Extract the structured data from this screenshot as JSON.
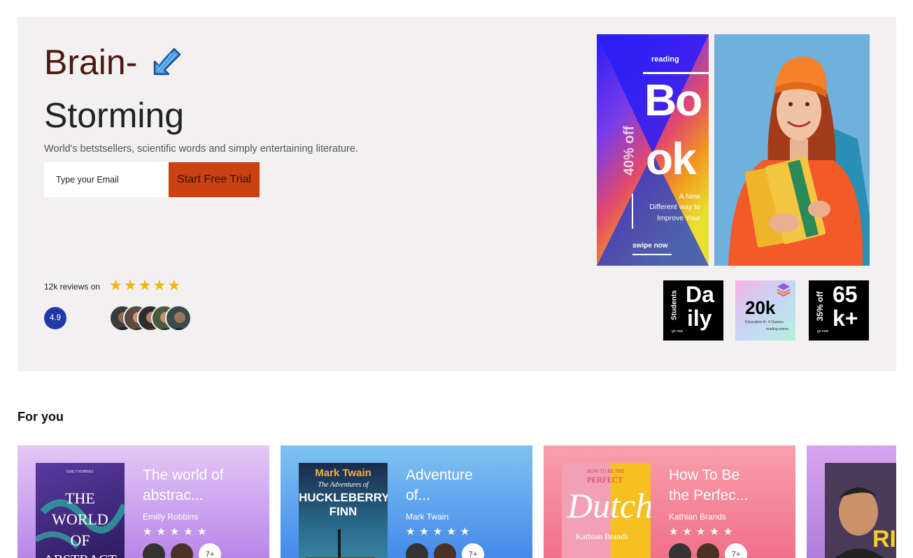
{
  "hero": {
    "title_line1": "Brain-",
    "title_line2": "Storming",
    "subtitle": "World's betstsellers, scientific words and simply entertaining literature.",
    "email_placeholder": "Type your Email",
    "cta_label": "Start Free Trial",
    "reviews_text": "12k reviews on",
    "star_count": 5,
    "rating": "4.9",
    "avatar_count": 5,
    "book_cover": {
      "top_word": "reading",
      "big_text_line1": "Bo",
      "big_text_line2": "ok",
      "discount": "40% off",
      "tagline_line1": "A New",
      "tagline_line2": "Different way to",
      "tagline_line3": "Improve Your",
      "cta": "swipe now"
    },
    "thumbs": [
      {
        "side_text": "Students",
        "main_line1": "Da",
        "main_line2": "ily",
        "small": "go now"
      },
      {
        "main": "20k",
        "small": "Education A- 4 Games",
        "small2": "reading rooms"
      },
      {
        "side_text": "35% off",
        "main_line1": "65",
        "main_line2": "k+",
        "small": "go now"
      }
    ]
  },
  "section": {
    "title": "For you"
  },
  "cards": [
    {
      "title": "The world of abstrac...",
      "author": "Emilly Robbins",
      "more": "7+",
      "cover_title_1": "THE",
      "cover_title_2": "WORLD",
      "cover_title_3": "OF",
      "cover_title_4": "ABSTRACT",
      "cover_author": "EMILY ROBBINS"
    },
    {
      "title": "Adventure of...",
      "author": "Mark Twain",
      "more": "7+",
      "cover_author": "Mark Twain",
      "cover_sub": "The Adventures of",
      "cover_title_1": "HUCKLEBERRY",
      "cover_title_2": "FINN"
    },
    {
      "title": "How To Be the Perfec...",
      "author": "Kathian Brands",
      "more": "7+",
      "cover_top_1": "HOW TO BE THE",
      "cover_top_2": "PERFECT",
      "cover_title": "Dutch",
      "cover_author": "Kathian Brands"
    },
    {
      "cover_title": "RIC"
    }
  ],
  "colors": {
    "hero_bg": "#f2f0f1",
    "cta_bg": "#c9420f",
    "rating_badge": "#1f3aa8",
    "star": "#f5b50c",
    "card1_gradient": [
      "#e4c8f5",
      "#b37ee8"
    ],
    "card2_gradient": [
      "#7ec3f0",
      "#3f83ea"
    ],
    "card3_gradient": [
      "#f8a0ac",
      "#f06a85"
    ],
    "card4_gradient": [
      "#d8a5ef",
      "#a97ad8"
    ]
  },
  "icons": [
    "hand-drawn-arrow-icon",
    "star-icon"
  ]
}
